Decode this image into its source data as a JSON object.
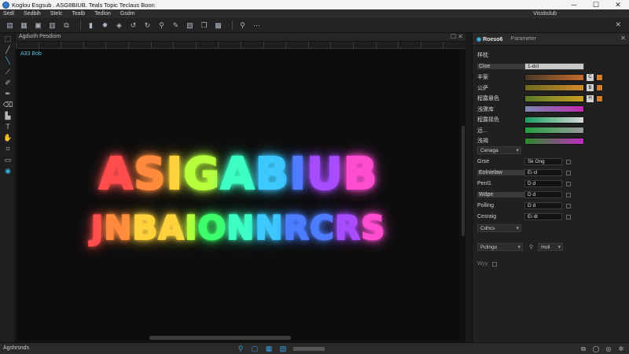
{
  "window": {
    "title": "Koglou Esgsub . ASG8BIUB. Teals Topic Teclaus Boon",
    "minimize": "─",
    "maximize": "☐",
    "close": "✕"
  },
  "menu": {
    "items": [
      "Sedl",
      "Sedbih",
      "Stelc",
      "Tealb",
      "Tedlon",
      "Gsdm"
    ],
    "workspace": "Vissbslub"
  },
  "document": {
    "tab_title": "Agdurih Pesdiom",
    "layer_label": "A33 Bob",
    "neon_line1": "ASIGABIUB",
    "neon_line2": "JNBAIONNRCRS",
    "neon_colors": [
      "#ff4d4d",
      "#ff8a3d",
      "#ffd23d",
      "#b8ff3d",
      "#3dff6a",
      "#3dffc4",
      "#3dc9ff",
      "#4d7dff",
      "#a64dff",
      "#ff4dd2"
    ]
  },
  "panel": {
    "tabs": [
      "Roeso6",
      "Parameter"
    ],
    "section_title": "样枕",
    "rows": [
      {
        "label": "Cloe",
        "value": "1-dcl",
        "kind": "pale"
      },
      {
        "label": "丰案",
        "color_from": "#4a3a2a",
        "color_to": "#c46a2a",
        "btn": "C"
      },
      {
        "label": "公萨",
        "color_from": "#6a6a20",
        "color_to": "#d08a2a",
        "btn": "B"
      },
      {
        "label": "程露悬色",
        "color_from": "#5a7a2a",
        "color_to": "#c8a020",
        "btn": "H"
      },
      {
        "label": "浅骤库",
        "color_from": "#7a8ab0",
        "color_to": "#c02ab0",
        "btn": ""
      },
      {
        "label": "程露摇色",
        "color_from": "#1aa060",
        "color_to": "#d8d8d8",
        "btn": ""
      },
      {
        "label": "远...",
        "color_from": "#20a040",
        "color_to": "#9a9a9a",
        "btn": ""
      },
      {
        "label": "浅褐",
        "color_from": "#2a8a2a",
        "color_to": "#c02ac0",
        "btn": ""
      }
    ],
    "dropdown1": "Cenaga",
    "props": [
      {
        "label": "Grse",
        "value": "Sk Ong"
      },
      {
        "label": "Eolnielaw",
        "value": "Ei cl"
      },
      {
        "label": "Penl1",
        "value": "D d"
      },
      {
        "label": "Wdpe",
        "value": "D d"
      },
      {
        "label": "Polling",
        "value": "D d"
      },
      {
        "label": "Cesraig",
        "value": "Ei dl"
      }
    ],
    "dropdown2": "Cdhcs",
    "footer_field": "Pcllngo",
    "footer_btn": "Holl",
    "footer2": "Wyy"
  },
  "status": {
    "left": "Agshrsnds"
  }
}
